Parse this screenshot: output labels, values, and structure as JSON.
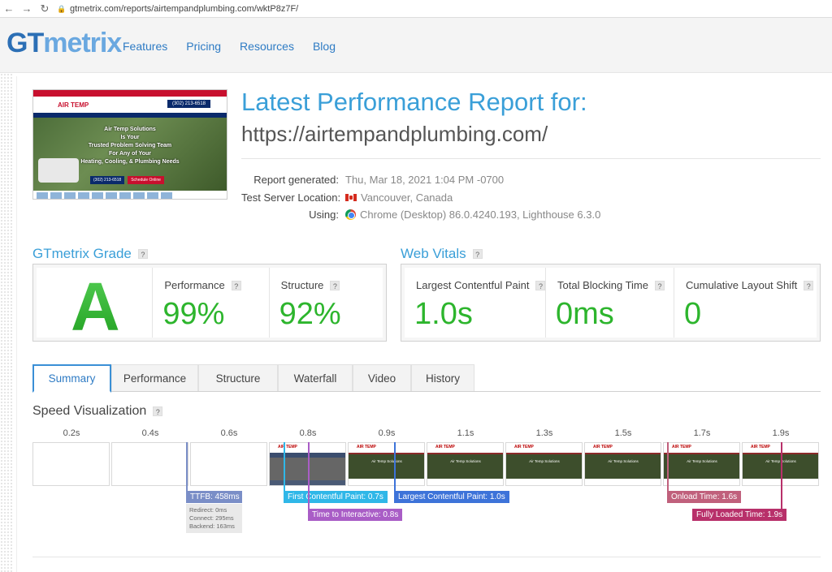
{
  "browser": {
    "back": "←",
    "forward": "→",
    "reload": "↻",
    "url": "gtmetrix.com/reports/airtempandplumbing.com/wktP8z7F/"
  },
  "header": {
    "logo_gt": "GT",
    "logo_metrix": "metrix",
    "nav": [
      "Features",
      "Pricing",
      "Resources",
      "Blog"
    ]
  },
  "thumbnail": {
    "brand": "AIR TEMP",
    "phone": "(302) 213-6518",
    "hero_lines": [
      "Air Temp Solutions",
      "Is Your",
      "Trusted Problem Solving Team",
      "For Any of Your",
      "Heating, Cooling, & Plumbing Needs"
    ],
    "btn_phone": "(302) 213-6518",
    "btn_schedule": "Schedule Online"
  },
  "report": {
    "title": "Latest Performance Report for:",
    "url": "https://airtempandplumbing.com/",
    "generated_label": "Report generated:",
    "generated_value": "Thu, Mar 18, 2021 1:04 PM -0700",
    "location_label": "Test Server Location:",
    "location_value": "Vancouver, Canada",
    "using_label": "Using:",
    "using_value": "Chrome (Desktop) 86.0.4240.193, Lighthouse 6.3.0"
  },
  "grade": {
    "heading": "GTmetrix Grade",
    "letter": "A",
    "performance_label": "Performance",
    "performance_value": "99%",
    "structure_label": "Structure",
    "structure_value": "92%"
  },
  "vitals": {
    "heading": "Web Vitals",
    "lcp_label": "Largest Contentful Paint",
    "lcp_value": "1.0s",
    "tbt_label": "Total Blocking Time",
    "tbt_value": "0ms",
    "cls_label": "Cumulative Layout Shift",
    "cls_value": "0"
  },
  "help": "?",
  "tabs": [
    "Summary",
    "Performance",
    "Structure",
    "Waterfall",
    "Video",
    "History"
  ],
  "speed": {
    "title": "Speed Visualization",
    "times": [
      "0.2s",
      "0.4s",
      "0.6s",
      "0.8s",
      "0.9s",
      "1.1s",
      "1.3s",
      "1.5s",
      "1.7s",
      "1.9s"
    ],
    "ttfb": "TTFB: 458ms",
    "redirect": "Redirect: 0ms",
    "connect": "Connect: 295ms",
    "backend": "Backend: 163ms",
    "fcp": "First Contentful Paint: 0.7s",
    "tti": "Time to Interactive: 0.8s",
    "lcp": "Largest Contentful Paint: 1.0s",
    "onload": "Onload Time: 1.6s",
    "fully_loaded": "Fully Loaded Time: 1.9s",
    "colors": {
      "ttfb": "#7a8ec7",
      "fcp": "#2fb7e8",
      "tti": "#a95dc6",
      "lcp": "#3d73d9",
      "onload": "#c0607c",
      "fully": "#b8306a"
    }
  }
}
